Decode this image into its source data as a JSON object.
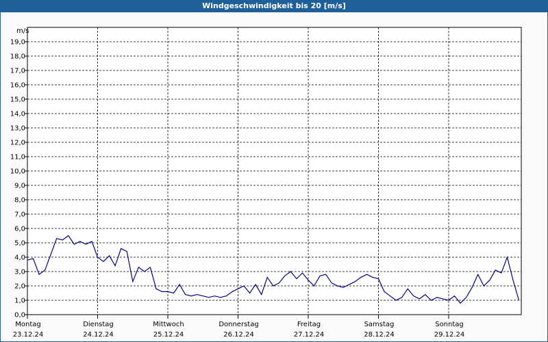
{
  "title": "Windgeschwindigkeit bis 20 [m/s]",
  "chart_data": {
    "type": "line",
    "title": "Windgeschwindigkeit bis 20 [m/s]",
    "ylabel": "m/s",
    "ylim": [
      0,
      20
    ],
    "yticks": [
      "0,0",
      "1,0",
      "2,0",
      "3,0",
      "4,0",
      "5,0",
      "6,0",
      "7,0",
      "8,0",
      "9,0",
      "10,0",
      "11,0",
      "12,0",
      "13,0",
      "14,0",
      "15,0",
      "16,0",
      "17,0",
      "18,0",
      "19,0"
    ],
    "days": [
      {
        "name": "Montag",
        "date": "23.12.24"
      },
      {
        "name": "Dienstag",
        "date": "24.12.24"
      },
      {
        "name": "Mittwoch",
        "date": "25.12.24"
      },
      {
        "name": "Donnerstag",
        "date": "26.12.24"
      },
      {
        "name": "Freitag",
        "date": "27.12.24"
      },
      {
        "name": "Samstag",
        "date": "28.12.24"
      },
      {
        "name": "Sonntag",
        "date": "29.12.24"
      }
    ],
    "grid": true,
    "line_color": "#00008b",
    "series": [
      {
        "x_unit": "hours from Montag 23.12.24 00:00",
        "x": [
          0,
          2,
          4,
          6,
          8,
          10,
          12,
          14,
          16,
          18,
          20,
          22,
          24,
          26,
          28,
          30,
          32,
          34,
          36,
          38,
          40,
          42,
          44,
          46,
          48,
          50,
          52,
          54,
          56,
          58,
          60,
          62,
          64,
          66,
          68,
          70,
          72,
          74,
          76,
          78,
          80,
          82,
          84,
          86,
          88,
          90,
          92,
          94,
          96,
          98,
          100,
          102,
          104,
          106,
          108,
          110,
          112,
          114,
          116,
          118,
          120,
          122,
          124,
          126,
          128,
          130,
          132,
          134,
          136,
          138,
          140,
          142,
          144,
          146,
          148,
          150,
          152,
          154,
          156,
          158,
          160,
          162,
          164,
          166,
          168
        ],
        "y": [
          3.8,
          3.9,
          2.8,
          3.1,
          4.2,
          5.3,
          5.2,
          5.5,
          4.9,
          5.1,
          4.9,
          5.1,
          4.0,
          3.7,
          4.1,
          3.4,
          4.6,
          4.4,
          2.3,
          3.3,
          3.0,
          3.3,
          1.8,
          1.6,
          1.6,
          1.5,
          2.1,
          1.4,
          1.3,
          1.4,
          1.3,
          1.2,
          1.3,
          1.2,
          1.3,
          1.6,
          1.8,
          2.0,
          1.5,
          2.1,
          1.4,
          2.6,
          2.0,
          2.2,
          2.7,
          3.0,
          2.5,
          2.9,
          2.4,
          2.0,
          2.7,
          2.8,
          2.2,
          2.0,
          1.9,
          2.1,
          2.3,
          2.6,
          2.8,
          2.6,
          2.5,
          1.6,
          1.3,
          1.0,
          1.2,
          1.8,
          1.3,
          1.1,
          1.4,
          1.0,
          1.2,
          1.1,
          1.0,
          1.3,
          0.8,
          1.2,
          1.9,
          2.8,
          2.0,
          2.4,
          3.1,
          2.9,
          4.0,
          2.4,
          1.0
        ]
      }
    ]
  }
}
